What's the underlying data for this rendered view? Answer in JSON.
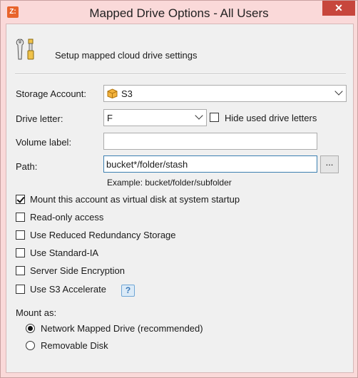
{
  "window": {
    "title": "Mapped Drive Options - All Users",
    "app_icon_text": "Z:",
    "close_glyph": "✕",
    "titlebar_color": "#fad9d9",
    "close_color": "#c7463c"
  },
  "header": {
    "icon": "tools-icon",
    "text": "Setup mapped cloud drive settings"
  },
  "fields": {
    "storage_account": {
      "label": "Storage Account:",
      "value": "S3",
      "icon": "s3-cube-icon"
    },
    "drive_letter": {
      "label": "Drive letter:",
      "value": "F"
    },
    "hide_used": {
      "label": "Hide used drive letters",
      "checked": false
    },
    "volume_label": {
      "label": "Volume label:",
      "value": ""
    },
    "path": {
      "label": "Path:",
      "value": "bucket*/folder/stash",
      "browse_label": "...",
      "example": "Example: bucket/folder/subfolder"
    }
  },
  "options": [
    {
      "label": "Mount this account as virtual disk at system startup",
      "checked": true
    },
    {
      "label": "Read-only access",
      "checked": false
    },
    {
      "label": "Use Reduced Redundancy Storage",
      "checked": false
    },
    {
      "label": "Use Standard-IA",
      "checked": false
    },
    {
      "label": "Server Side Encryption",
      "checked": false
    },
    {
      "label": "Use S3 Accelerate",
      "checked": false,
      "help": "?"
    }
  ],
  "mount_as": {
    "label": "Mount as:",
    "choices": [
      {
        "label": "Network Mapped Drive (recommended)",
        "selected": true
      },
      {
        "label": "Removable Disk",
        "selected": false
      }
    ]
  }
}
